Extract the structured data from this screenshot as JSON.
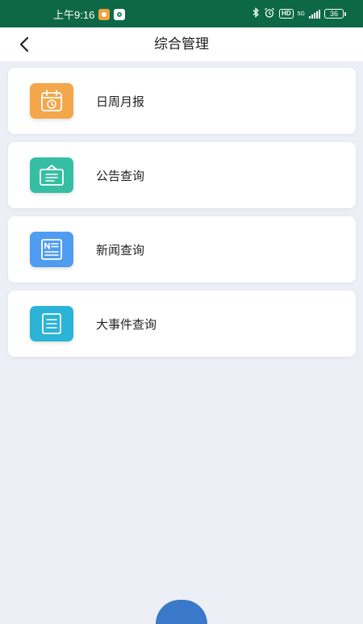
{
  "status_bar": {
    "time": "上午9:16",
    "icons": [
      "qq-notification-icon",
      "app-notification-icon",
      "bluetooth-icon",
      "alarm-icon",
      "hd-icon",
      "signal-icon",
      "battery-icon"
    ],
    "hd": "HD",
    "network": "5G",
    "battery": "36"
  },
  "header": {
    "title": "综合管理",
    "back_icon": "chevron-left-icon"
  },
  "menu": [
    {
      "label": "日周月报",
      "icon": "calendar-clock-icon",
      "color": "#f3a64a"
    },
    {
      "label": "公告查询",
      "icon": "notice-board-icon",
      "color": "#35bea3"
    },
    {
      "label": "新闻查询",
      "icon": "newspaper-icon",
      "color": "#4f9cf0"
    },
    {
      "label": "大事件查询",
      "icon": "document-list-icon",
      "color": "#2bb3d8"
    }
  ],
  "colors": {
    "status_bar": "#0d6848",
    "page_background": "#eceff6",
    "card_background": "#ffffff"
  }
}
